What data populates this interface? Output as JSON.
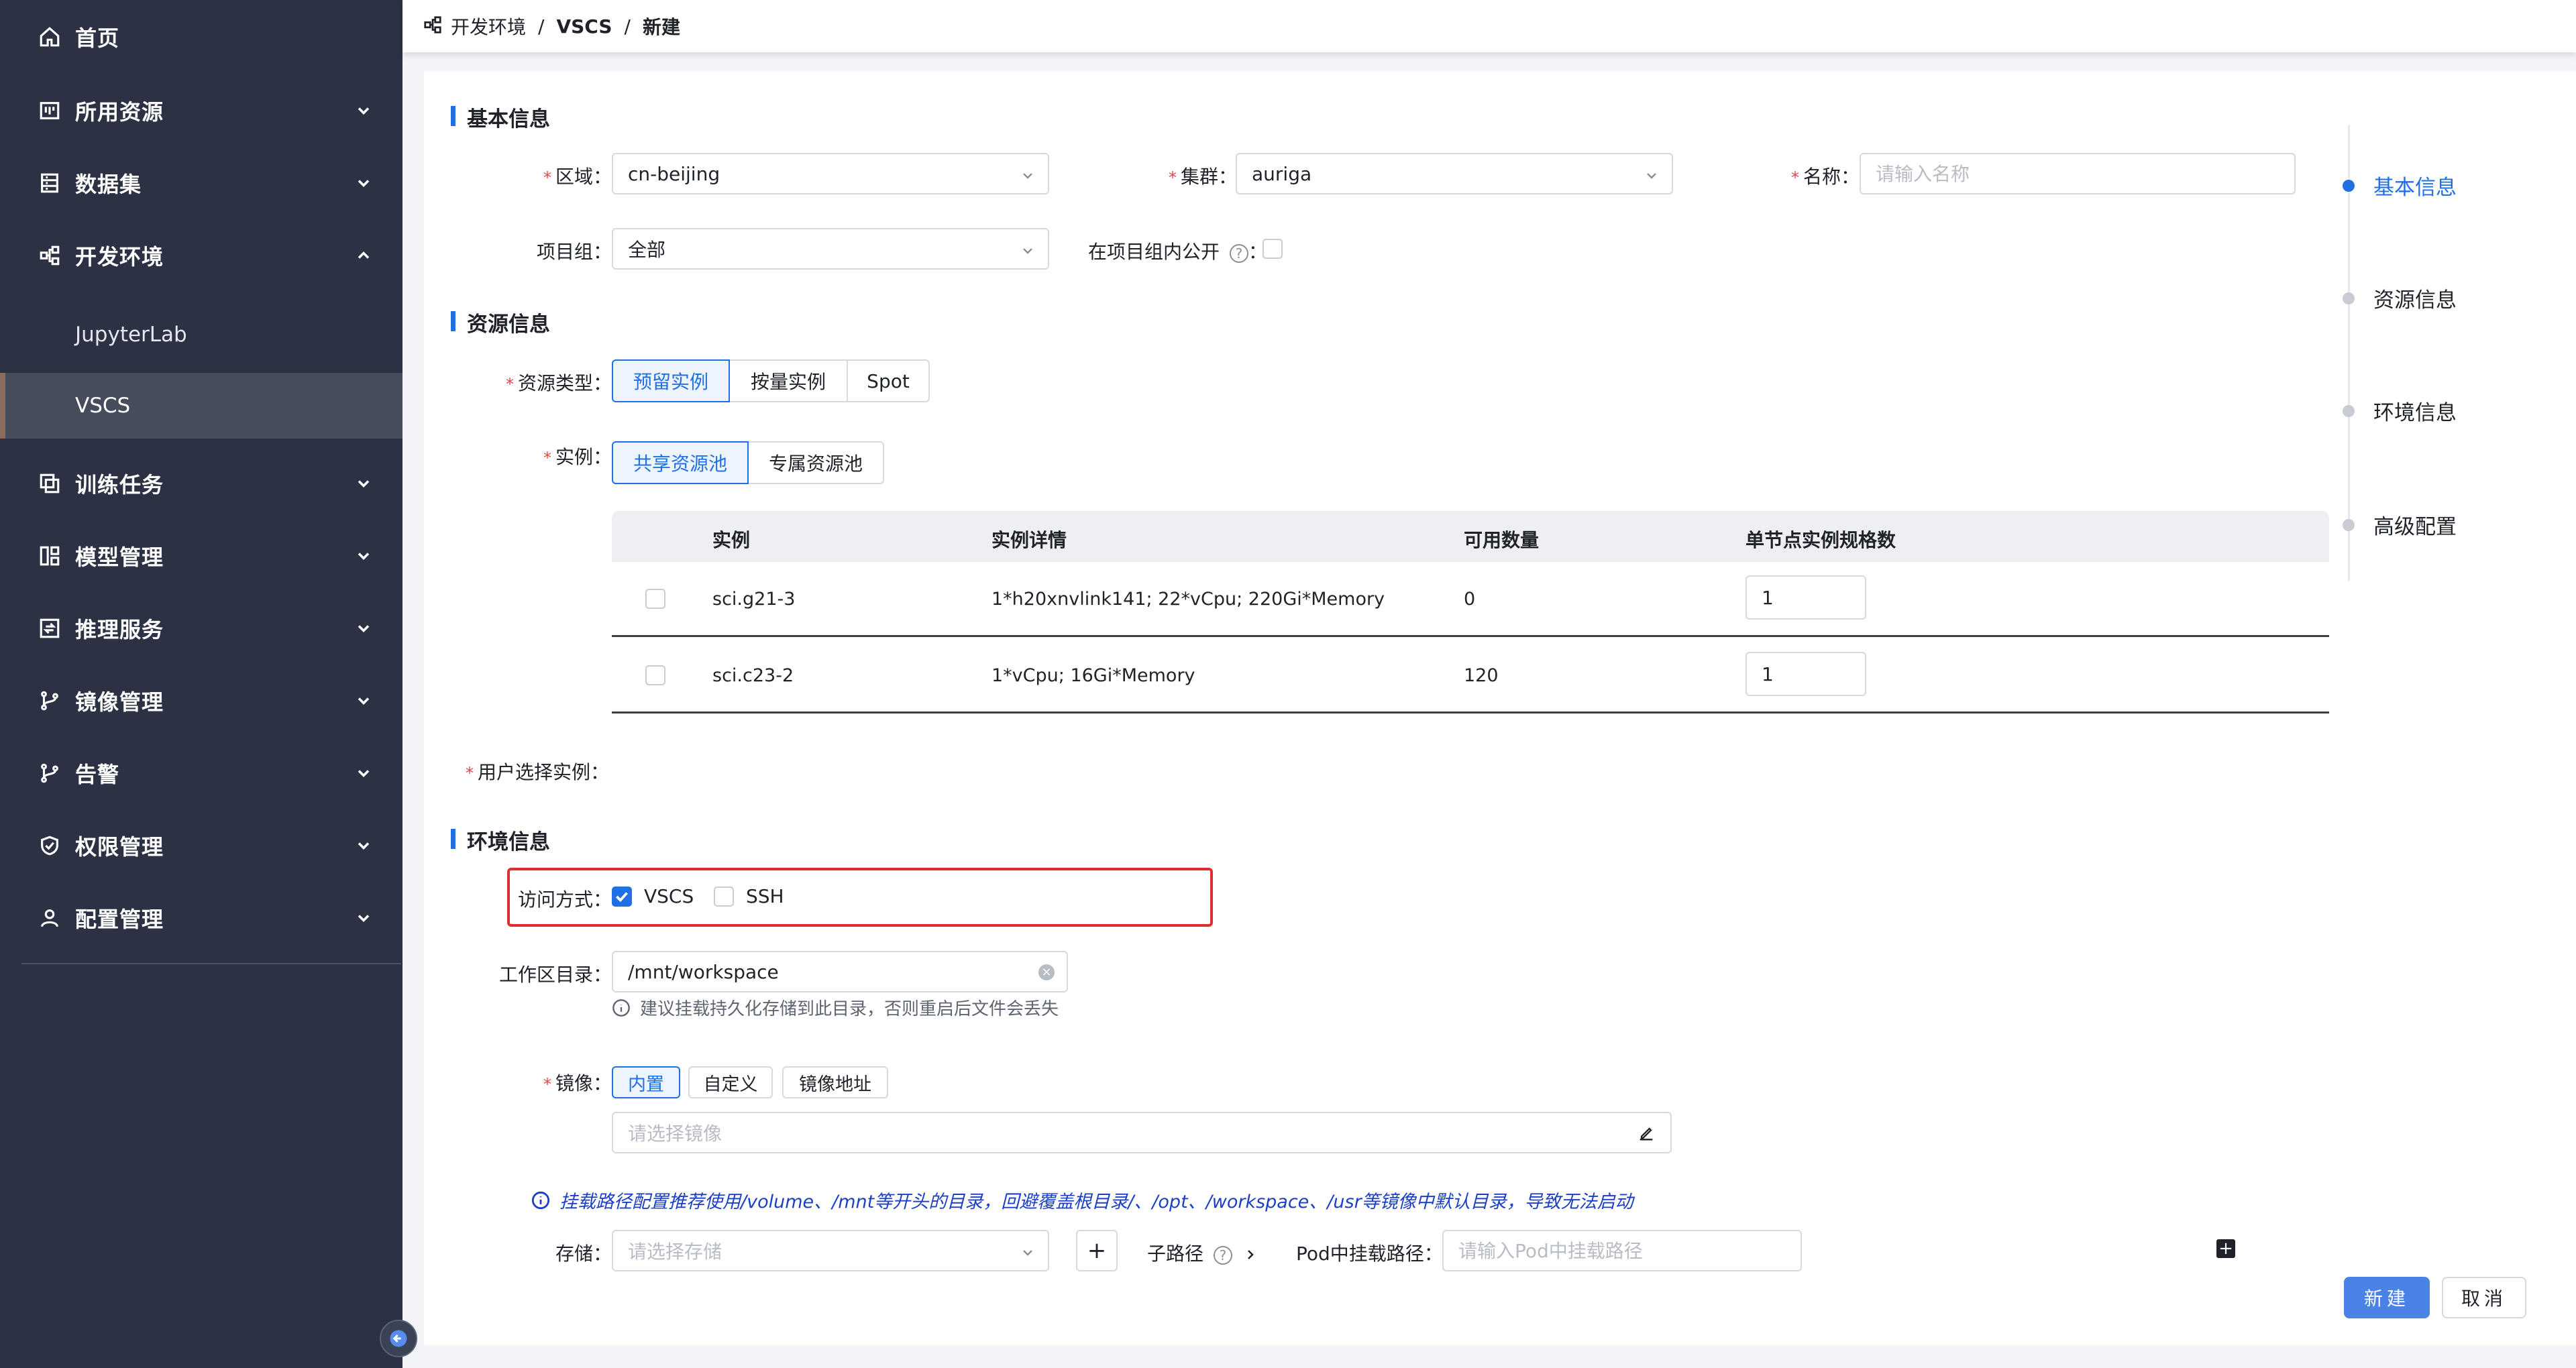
{
  "sidebar": {
    "items": [
      {
        "label": "首页",
        "icon": "home-icon"
      },
      {
        "label": "所用资源",
        "icon": "resource-icon"
      },
      {
        "label": "数据集",
        "icon": "dataset-icon"
      },
      {
        "label": "开发环境",
        "icon": "dev-env-icon"
      },
      {
        "label": "训练任务",
        "icon": "training-icon"
      },
      {
        "label": "模型管理",
        "icon": "model-icon"
      },
      {
        "label": "推理服务",
        "icon": "inference-icon"
      },
      {
        "label": "镜像管理",
        "icon": "image-branch-icon"
      },
      {
        "label": "告警",
        "icon": "alarm-branch-icon"
      },
      {
        "label": "权限管理",
        "icon": "shield-icon"
      },
      {
        "label": "配置管理",
        "icon": "user-icon"
      }
    ],
    "sub_items": [
      {
        "label": "JupyterLab"
      },
      {
        "label": "VSCS"
      }
    ]
  },
  "breadcrumb": {
    "level1": "开发环境",
    "level2": "VSCS",
    "level3": "新建",
    "separator": "/"
  },
  "basic": {
    "title": "基本信息",
    "region_label": "区域：",
    "region_value": "cn-beijing",
    "cluster_label": "集群：",
    "cluster_value": "auriga",
    "name_label": "名称：",
    "name_placeholder": "请输入名称",
    "project_label": "项目组：",
    "project_value": "全部",
    "public_label": "在项目组内公开",
    "public_suffix": "："
  },
  "resource": {
    "title": "资源信息",
    "type_label": "资源类型：",
    "type_options": [
      "预留实例",
      "按量实例",
      "Spot"
    ],
    "instance_label": "实例：",
    "pool_options": [
      "共享资源池",
      "专属资源池"
    ],
    "table": {
      "headers": [
        "实例",
        "实例详情",
        "可用数量",
        "单节点实例规格数"
      ],
      "rows": [
        {
          "name": "sci.g21-3",
          "detail": "1*h20xnvlink141; 22*vCpu; 220Gi*Memory",
          "available": "0",
          "spec": "1"
        },
        {
          "name": "sci.c23-2",
          "detail": "1*vCpu; 16Gi*Memory",
          "available": "120",
          "spec": "1"
        }
      ]
    },
    "user_selected_label": "用户选择实例："
  },
  "env": {
    "title": "环境信息",
    "access_label": "访问方式：",
    "access_vscs": "VSCS",
    "access_ssh": "SSH",
    "workdir_label": "工作区目录：",
    "workdir_value": "/mnt/workspace",
    "workdir_hint": "建议挂载持久化存储到此目录，否则重启后文件会丢失",
    "image_label": "镜像：",
    "image_options": [
      "内置",
      "自定义",
      "镜像地址"
    ],
    "image_placeholder": "请选择镜像",
    "mount_notice": "挂载路径配置推荐使用/volume、/mnt等开头的目录，回避覆盖根目录/、/opt、/workspace、/usr等镜像中默认目录，导致无法启动",
    "storage_label": "存储：",
    "storage_placeholder": "请选择存储",
    "add_symbol": "+",
    "subpath_label": "子路径",
    "pod_path_label": "Pod中挂载路径：",
    "pod_path_placeholder": "请输入Pod中挂载路径"
  },
  "steps": [
    {
      "label": "基本信息"
    },
    {
      "label": "资源信息"
    },
    {
      "label": "环境信息"
    },
    {
      "label": "高级配置"
    }
  ],
  "actions": {
    "create": "新建",
    "cancel": "取消"
  },
  "colors": {
    "sidebar_bg": "#2c3244",
    "accent": "#1f6fe5",
    "primary_button": "#4a82e6",
    "highlight": "#e02d2d",
    "notice_text": "#1c3fc8"
  }
}
